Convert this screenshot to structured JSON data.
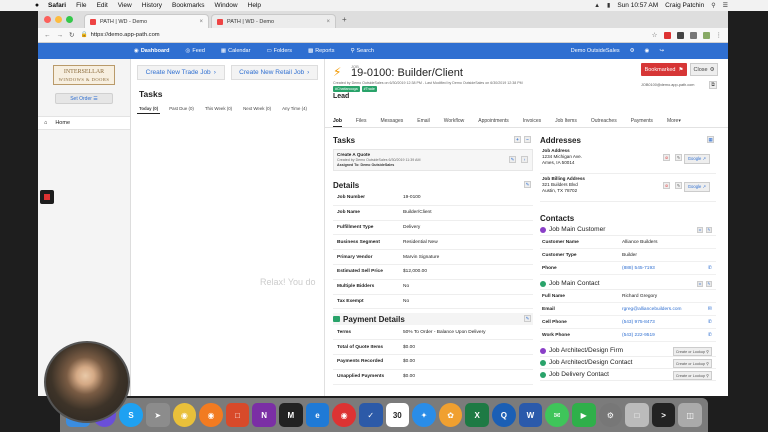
{
  "menubar": {
    "apple": "",
    "items": [
      "Safari",
      "File",
      "Edit",
      "View",
      "History",
      "Bookmarks",
      "Window",
      "Help"
    ],
    "datetime": "Sun 10:57 AM",
    "user": "Craig Patchin"
  },
  "browser": {
    "tabs": [
      {
        "title": "PATH | WD - Demo",
        "active": true
      },
      {
        "title": "PATH | WD - Demo",
        "active": false
      }
    ],
    "url": "https://demo.app-path.com"
  },
  "app_nav": {
    "items": [
      "Dashboard",
      "Feed",
      "Calendar",
      "Folders",
      "Reports",
      "Search"
    ],
    "user": "Demo OutsideSales"
  },
  "left_nav": {
    "logo_line1": "INTERSELLAR",
    "logo_line2": "WINDOWS & DOORS",
    "set_order": "Set Order",
    "home": "Home"
  },
  "center": {
    "create_trade": "Create New Trade Job",
    "create_retail": "Create New Retail Job",
    "tasks_title": "Tasks",
    "tabs": [
      "Today (0)",
      "Past Due (0)",
      "This Week (0)",
      "Next Week (0)",
      "Any Time (4)"
    ],
    "relax": "Relax! You do"
  },
  "record": {
    "type": "JOB",
    "title": "19-0100: Builder/Client",
    "meta": "Created by Demo OutsideSales on 6/30/2019 12:38 PM - Last Modified by Demo OutsideSales on 6/30/2019 12:38 PM",
    "tags": [
      "#Chattanooga",
      "#Trade"
    ],
    "stage": "Lead",
    "bookmarked": "Bookmarked",
    "close": "Close",
    "email": "JOB0100@demo.app-path.com",
    "tabs": [
      "Job",
      "Files",
      "Messages",
      "Email",
      "Workflow",
      "Appointments",
      "Invoices",
      "Job Items",
      "Outreaches",
      "Payments",
      "More"
    ]
  },
  "tasks_section": {
    "title": "Tasks",
    "card_title": "Create A Quote",
    "card_created": "Created by Demo OutsideSales 6/30/2019 11:39 AM",
    "card_assigned": "Assigned To: Demo OutsideSales"
  },
  "details": {
    "title": "Details",
    "rows": [
      {
        "k": "Job Number",
        "v": "19-0100"
      },
      {
        "k": "Job Name",
        "v": "Builder/Client"
      },
      {
        "k": "Fulfillment Type",
        "v": "Delivery"
      },
      {
        "k": "Business Segment",
        "v": "Residential New"
      },
      {
        "k": "Primary Vendor",
        "v": "Marvin Signature"
      },
      {
        "k": "Estimated Sell Price",
        "v": "$12,000.00"
      },
      {
        "k": "Multiple Bidders",
        "v": "No"
      },
      {
        "k": "Tax Exempt",
        "v": "No"
      }
    ]
  },
  "payment": {
    "title": "Payment Details",
    "rows": [
      {
        "k": "Terms",
        "v": "50% To Order - Balance Upon Delivery"
      },
      {
        "k": "Total of Quote Items",
        "v": "$0.00"
      },
      {
        "k": "Payments Recorded",
        "v": "$0.00"
      },
      {
        "k": "Unapplied Payments",
        "v": "$0.00"
      }
    ]
  },
  "addresses": {
    "title": "Addresses",
    "items": [
      {
        "h": "Job Address",
        "l1": "1234 Michigan Ave.",
        "l2": "Ames, IA 50014",
        "google": "Google"
      },
      {
        "h": "Job Billing Address",
        "l1": "321 Builders Blvd",
        "l2": "Austin, TX 78702",
        "google": "Google"
      }
    ]
  },
  "contacts": {
    "title": "Contacts",
    "main_customer": {
      "h": "Job Main Customer",
      "rows": [
        {
          "k": "Customer Name",
          "v": "Alliance Builders"
        },
        {
          "k": "Customer Type",
          "v": "Builder"
        },
        {
          "k": "Phone",
          "v": "(888) 545-7193"
        }
      ]
    },
    "main_contact": {
      "h": "Job Main Contact",
      "rows": [
        {
          "k": "Full Name",
          "v": "Richard Gregory"
        },
        {
          "k": "Email",
          "v": "rgreg@alliancebuilders.com"
        },
        {
          "k": "Cell Phone",
          "v": "(543) 975-8473"
        },
        {
          "k": "Work Phone",
          "v": "(543) 222-9519"
        }
      ]
    },
    "others": [
      {
        "h": "Job Architect/Design Firm",
        "btn": "Create or Lookup"
      },
      {
        "h": "Job Architect/Design Contact",
        "btn": "Create or Lookup"
      },
      {
        "h": "Job Delivery Contact",
        "btn": "Create or Lookup"
      }
    ]
  },
  "dock": {
    "apps": [
      "finder-icon",
      "siri-icon",
      "skype-icon",
      "launchpad-icon",
      "chrome-icon",
      "firefox-icon",
      "keynote-icon",
      "onenote-icon",
      "miro-icon",
      "edge-icon",
      "screenflow-icon",
      "notes-icon",
      "calendar-icon",
      "safari-icon",
      "photos-icon",
      "excel-icon",
      "quicktime-icon",
      "word-icon",
      "messages-icon",
      "facetime-icon",
      "system-preferences-icon",
      "preview-icon",
      "terminal-icon",
      "trash-icon"
    ],
    "calendar_day": "30"
  },
  "colors": {
    "accent": "#2f6fd1",
    "bookmark": "#d63636",
    "tag": "#29a36a",
    "job_icon": "#f29900"
  }
}
